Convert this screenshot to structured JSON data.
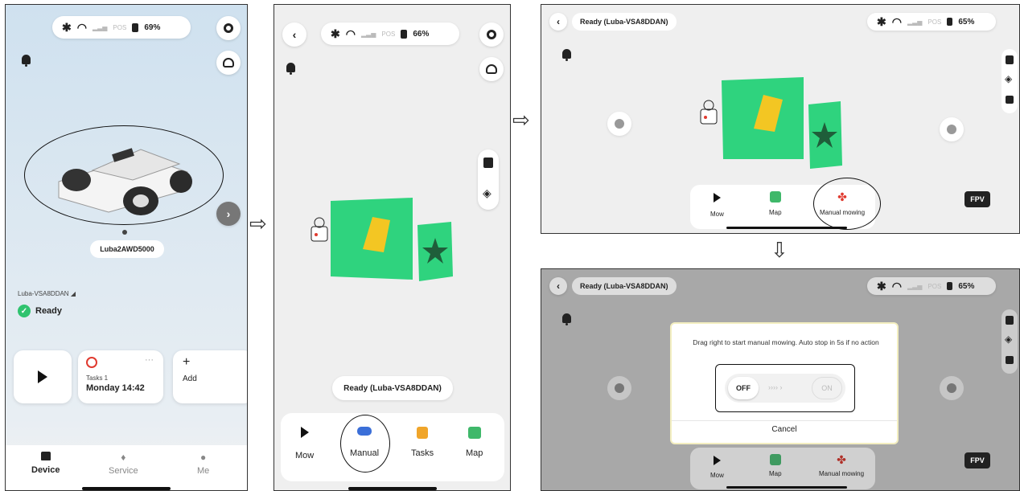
{
  "common": {
    "connectivity": "POS",
    "tabs": {
      "mow": "Mow",
      "map": "Map"
    }
  },
  "panel1": {
    "battery": "69%",
    "device_name": "Luba2AWD5000",
    "wifi_name": "Luba-VSA8DDAN",
    "status": "Ready",
    "tasks_count": "Tasks 1",
    "tasks_time": "Monday 14:42",
    "more": "···",
    "add_label": "Add",
    "nav": {
      "device": "Device",
      "service": "Service",
      "me": "Me"
    }
  },
  "panel2": {
    "battery": "66%",
    "ready_banner": "Ready  (Luba-VSA8DDAN)",
    "tabs": {
      "manual": "Manual",
      "tasks": "Tasks"
    }
  },
  "panel3": {
    "title": "Ready  (Luba-VSA8DDAN)",
    "battery": "65%",
    "tab_manual": "Manual mowing",
    "fpv": "FPV"
  },
  "panel4": {
    "title": "Ready  (Luba-VSA8DDAN)",
    "battery": "65%",
    "dialog_text": "Drag right to start manual mowing. Auto stop in 5s if no action",
    "toggle_off": "OFF",
    "toggle_on": "ON",
    "toggle_arrows": "›››› ›",
    "cancel": "Cancel",
    "tab_manual": "Manual mowing",
    "fpv": "FPV"
  },
  "flow_arrows": {
    "right": "⇨",
    "down": "⇩"
  }
}
